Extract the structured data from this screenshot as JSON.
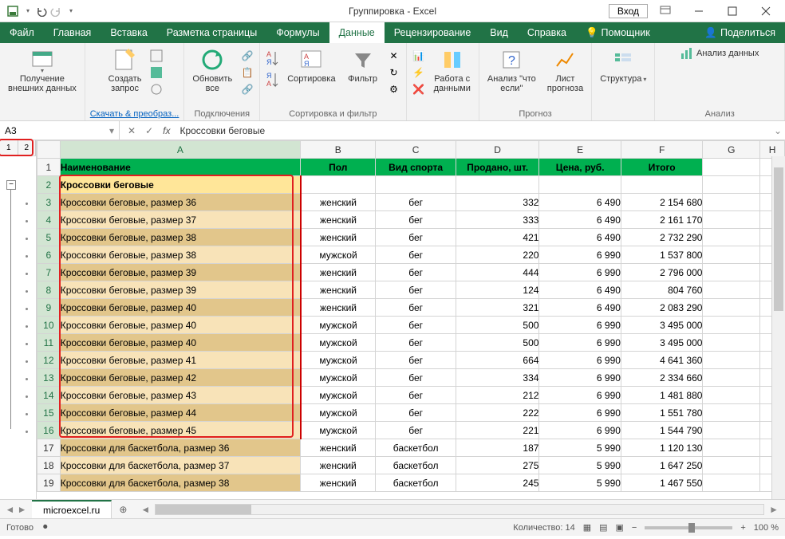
{
  "title": "Группировка  -  Excel",
  "login": "Вход",
  "tabs": [
    "Файл",
    "Главная",
    "Вставка",
    "Разметка страницы",
    "Формулы",
    "Данные",
    "Рецензирование",
    "Вид",
    "Справка"
  ],
  "activeTab": 5,
  "help": "Помощник",
  "share": "Поделиться",
  "ribbon": {
    "g1": {
      "btn": "Получение\nвнешних данных"
    },
    "g2": {
      "btn": "Создать\nзапрос",
      "label": "Скачать & преобраз..."
    },
    "g3": {
      "btn": "Обновить\nвсе",
      "label": "Подключения"
    },
    "g4": {
      "sort": "Сортировка",
      "filter": "Фильтр",
      "label": "Сортировка и фильтр"
    },
    "g5": {
      "btn": "Работа с\nданными"
    },
    "g6": {
      "btn1": "Анализ \"что\nесли\"",
      "btn2": "Лист\nпрогноза",
      "label": "Прогноз"
    },
    "g7": {
      "btn": "Структура"
    },
    "g8": {
      "btn": "Анализ данных",
      "label": "Анализ"
    }
  },
  "nameBox": "A3",
  "formula": "Кроссовки беговые",
  "outlineLevels": [
    "1",
    "2"
  ],
  "cols": [
    "A",
    "B",
    "C",
    "D",
    "E",
    "F",
    "G",
    "H"
  ],
  "headers": [
    "Наименование",
    "Пол",
    "Вид спорта",
    "Продано, шт.",
    "Цена, руб.",
    "Итого"
  ],
  "groupRow": "Кроссовки беговые",
  "rows": [
    {
      "n": 3,
      "name": "Кроссовки беговые, размер 36",
      "gen": "женский",
      "sport": "бег",
      "sold": "332",
      "price": "6 490",
      "total": "2 154 680"
    },
    {
      "n": 4,
      "name": "Кроссовки беговые, размер 37",
      "gen": "женский",
      "sport": "бег",
      "sold": "333",
      "price": "6 490",
      "total": "2 161 170"
    },
    {
      "n": 5,
      "name": "Кроссовки беговые, размер 38",
      "gen": "женский",
      "sport": "бег",
      "sold": "421",
      "price": "6 490",
      "total": "2 732 290"
    },
    {
      "n": 6,
      "name": "Кроссовки беговые, размер 38",
      "gen": "мужской",
      "sport": "бег",
      "sold": "220",
      "price": "6 990",
      "total": "1 537 800"
    },
    {
      "n": 7,
      "name": "Кроссовки беговые, размер 39",
      "gen": "женский",
      "sport": "бег",
      "sold": "444",
      "price": "6 990",
      "total": "2 796 000"
    },
    {
      "n": 8,
      "name": "Кроссовки беговые, размер 39",
      "gen": "женский",
      "sport": "бег",
      "sold": "124",
      "price": "6 490",
      "total": "804 760"
    },
    {
      "n": 9,
      "name": "Кроссовки беговые, размер 40",
      "gen": "женский",
      "sport": "бег",
      "sold": "321",
      "price": "6 490",
      "total": "2 083 290"
    },
    {
      "n": 10,
      "name": "Кроссовки беговые, размер 40",
      "gen": "мужской",
      "sport": "бег",
      "sold": "500",
      "price": "6 990",
      "total": "3 495 000"
    },
    {
      "n": 11,
      "name": "Кроссовки беговые, размер 40",
      "gen": "мужской",
      "sport": "бег",
      "sold": "500",
      "price": "6 990",
      "total": "3 495 000"
    },
    {
      "n": 12,
      "name": "Кроссовки беговые, размер 41",
      "gen": "мужской",
      "sport": "бег",
      "sold": "664",
      "price": "6 990",
      "total": "4 641 360"
    },
    {
      "n": 13,
      "name": "Кроссовки беговые, размер 42",
      "gen": "мужской",
      "sport": "бег",
      "sold": "334",
      "price": "6 990",
      "total": "2 334 660"
    },
    {
      "n": 14,
      "name": "Кроссовки беговые, размер 43",
      "gen": "мужской",
      "sport": "бег",
      "sold": "212",
      "price": "6 990",
      "total": "1 481 880"
    },
    {
      "n": 15,
      "name": "Кроссовки беговые, размер 44",
      "gen": "мужской",
      "sport": "бег",
      "sold": "222",
      "price": "6 990",
      "total": "1 551 780"
    },
    {
      "n": 16,
      "name": "Кроссовки беговые, размер 45",
      "gen": "мужской",
      "sport": "бег",
      "sold": "221",
      "price": "6 990",
      "total": "1 544 790"
    }
  ],
  "rows2": [
    {
      "n": 17,
      "name": "Кроссовки для баскетбола, размер 36",
      "gen": "женский",
      "sport": "баскетбол",
      "sold": "187",
      "price": "5 990",
      "total": "1 120 130"
    },
    {
      "n": 18,
      "name": "Кроссовки для баскетбола, размер 37",
      "gen": "женский",
      "sport": "баскетбол",
      "sold": "275",
      "price": "5 990",
      "total": "1 647 250"
    },
    {
      "n": 19,
      "name": "Кроссовки для баскетбола, размер 38",
      "gen": "женский",
      "sport": "баскетбол",
      "sold": "245",
      "price": "5 990",
      "total": "1 467 550"
    }
  ],
  "sheetName": "microexcel.ru",
  "status": {
    "ready": "Готово",
    "count": "Количество: 14",
    "zoom": "100 %"
  }
}
